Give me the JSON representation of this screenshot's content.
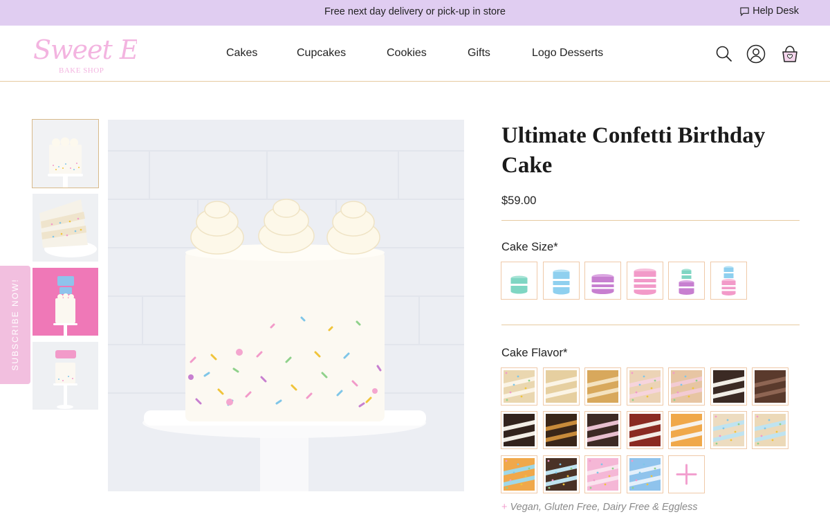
{
  "announcement": {
    "text": "Free next day delivery or pick-up in store",
    "help_label": "Help Desk"
  },
  "brand": {
    "name": "Sweet E's",
    "tagline": "BAKE SHOP",
    "accent_color": "#f3b4e0"
  },
  "nav": {
    "items": [
      {
        "label": "Cakes"
      },
      {
        "label": "Cupcakes"
      },
      {
        "label": "Cookies"
      },
      {
        "label": "Gifts"
      },
      {
        "label": "Logo Desserts"
      }
    ]
  },
  "header_icons": [
    "search-icon",
    "account-icon",
    "cart-icon"
  ],
  "subscribe": {
    "label": "SUBSCRIBE NOW!"
  },
  "gallery": {
    "thumbnails": [
      {
        "name": "thumb-cake-whole",
        "active": true
      },
      {
        "name": "thumb-cake-slice",
        "active": false
      },
      {
        "name": "thumb-cake-pink-background",
        "active": false
      },
      {
        "name": "thumb-cake-topper",
        "active": false
      }
    ]
  },
  "product": {
    "title": "Ultimate Confetti Birthday Cake",
    "price": "$59.00",
    "size_label": "Cake Size*",
    "flavor_label": "Cake Flavor*",
    "sizes": [
      {
        "name": "size-small-mint",
        "tiers": 1,
        "color": "#7fd6c3"
      },
      {
        "name": "size-medium-blue",
        "tiers": 1,
        "color": "#8fd0ef"
      },
      {
        "name": "size-wide-purple",
        "tiers": 1,
        "color": "#c77fd0"
      },
      {
        "name": "size-large-pink",
        "tiers": 1,
        "color": "#f29ac9"
      },
      {
        "name": "size-two-tier-mint-purple",
        "tiers": 2,
        "color": "#7fd6c3"
      },
      {
        "name": "size-two-tier-blue-pink",
        "tiers": 2,
        "color": "#8fd0ef"
      }
    ],
    "flavors": [
      {
        "name": "flavor-confetti",
        "sponge": "#ead7b0",
        "frosting": "#fbf4e6",
        "sprinkles": true
      },
      {
        "name": "flavor-vanilla",
        "sponge": "#e6cfa0",
        "frosting": "#fbf4e6",
        "sprinkles": false
      },
      {
        "name": "flavor-caramel",
        "sponge": "#d8a85c",
        "frosting": "#f4e2c0",
        "sprinkles": false
      },
      {
        "name": "flavor-strawberry-swirl",
        "sponge": "#ecd3b6",
        "frosting": "#f6d4dc",
        "sprinkles": true
      },
      {
        "name": "flavor-strawberry",
        "sponge": "#e7c5a3",
        "frosting": "#f3cbd3",
        "sprinkles": true
      },
      {
        "name": "flavor-cookies-cream",
        "sponge": "#3b2a24",
        "frosting": "#f1ede6",
        "sprinkles": false
      },
      {
        "name": "flavor-chocolate",
        "sponge": "#5a3a2c",
        "frosting": "#8e6553",
        "sprinkles": false
      },
      {
        "name": "flavor-chocolate-vanilla",
        "sponge": "#33231d",
        "frosting": "#f3eee6",
        "sprinkles": false
      },
      {
        "name": "flavor-chocolate-caramel",
        "sponge": "#3a2618",
        "frosting": "#c88b3a",
        "sprinkles": false
      },
      {
        "name": "flavor-chocolate-raspberry",
        "sponge": "#3d2a25",
        "frosting": "#e8bfcf",
        "sprinkles": false
      },
      {
        "name": "flavor-red-velvet",
        "sponge": "#8a2a22",
        "frosting": "#f3ece6",
        "sprinkles": false
      },
      {
        "name": "flavor-rainbow",
        "sponge": "#f0a84a",
        "frosting": "#f7f2ec",
        "sprinkles": false
      },
      {
        "name": "flavor-confetti-surprise",
        "sponge": "#eddcc0",
        "frosting": "#bfe3f0",
        "sprinkles": true
      },
      {
        "name": "flavor-confetti-blue-surprise",
        "sponge": "#ecd9b8",
        "frosting": "#bfe3f0",
        "sprinkles": true
      },
      {
        "name": "flavor-rainbow-surprise",
        "sponge": "#f0a84a",
        "frosting": "#9fd8e8",
        "sprinkles": true
      },
      {
        "name": "flavor-chocolate-surprise",
        "sponge": "#4a3226",
        "frosting": "#bfe3f0",
        "sprinkles": true
      },
      {
        "name": "flavor-pink-sprinkle",
        "sponge": "#f5b7d6",
        "frosting": "#fae3ee",
        "sprinkles": true
      },
      {
        "name": "flavor-blue-sprinkle",
        "sponge": "#8fc3ec",
        "frosting": "#e4f0fb",
        "sprinkles": true
      }
    ],
    "more_flavors_icon": "plus-icon",
    "dietary_note": "Vegan, Gluten Free, Dairy Free & Eggless",
    "dietary_plus": "+"
  }
}
